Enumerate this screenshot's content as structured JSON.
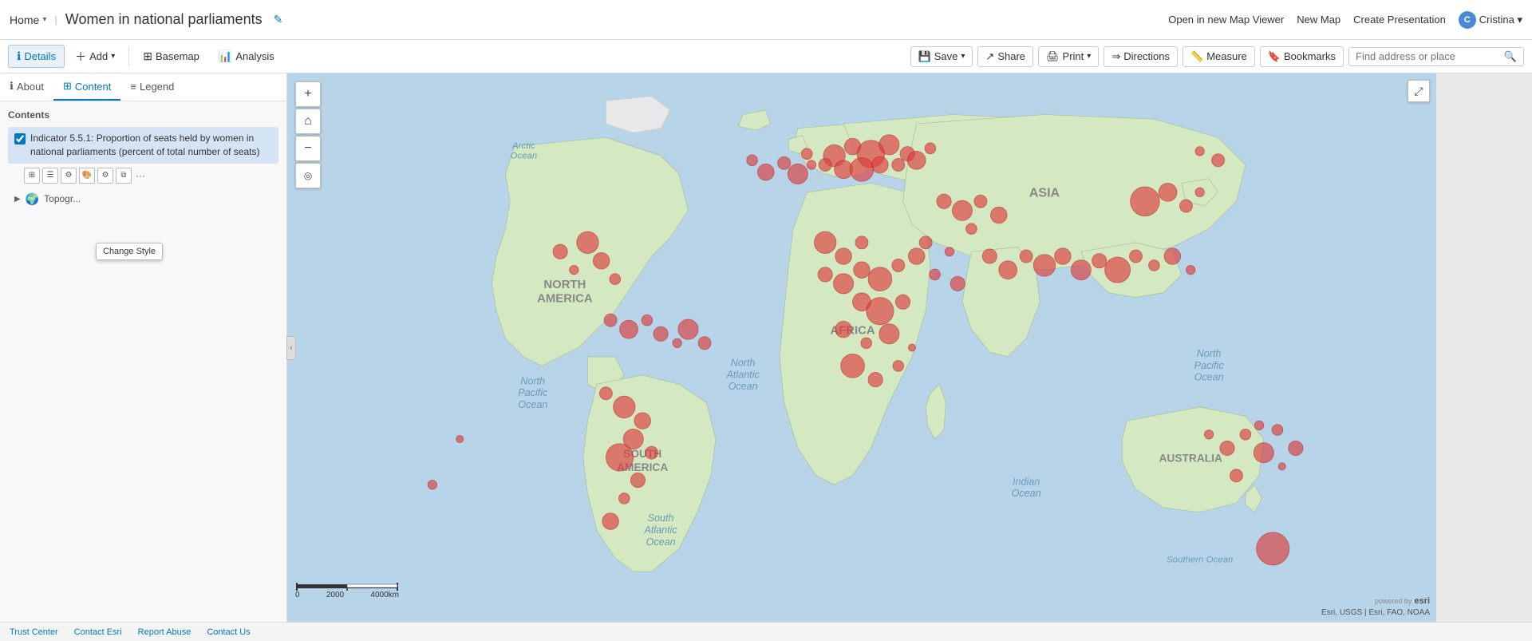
{
  "topbar": {
    "home_label": "Home",
    "home_chevron": "▾",
    "map_title": "Women in national parliaments",
    "edit_icon": "✎",
    "open_new_viewer": "Open in new Map Viewer",
    "new_map": "New Map",
    "create_presentation": "Create Presentation",
    "user_initials": "C",
    "user_name": "Cristina ▾"
  },
  "toolbar": {
    "details_label": "Details",
    "add_label": "Add",
    "basemap_label": "Basemap",
    "analysis_label": "Analysis",
    "save_label": "Save",
    "share_label": "Share",
    "print_label": "Print",
    "directions_label": "Directions",
    "measure_label": "Measure",
    "bookmarks_label": "Bookmarks",
    "search_placeholder": "Find address or place"
  },
  "sidebar": {
    "tab_about": "About",
    "tab_content": "Content",
    "tab_legend": "Legend",
    "contents_label": "Contents",
    "layer_name": "Indicator 5.5.1: Proportion of seats held by women in national parliaments (percent of total number of seats)",
    "topo_label": "Topogr...",
    "tooltip_label": "Change Style"
  },
  "scale": {
    "labels": [
      "0",
      "2000",
      "4000km"
    ]
  },
  "attribution": "Esri, USGS | Esri, FAO, NOAA",
  "footer": {
    "trust_center": "Trust Center",
    "contact_esri": "Contact Esri",
    "report_abuse": "Report Abuse",
    "contact_us": "Contact Us"
  }
}
